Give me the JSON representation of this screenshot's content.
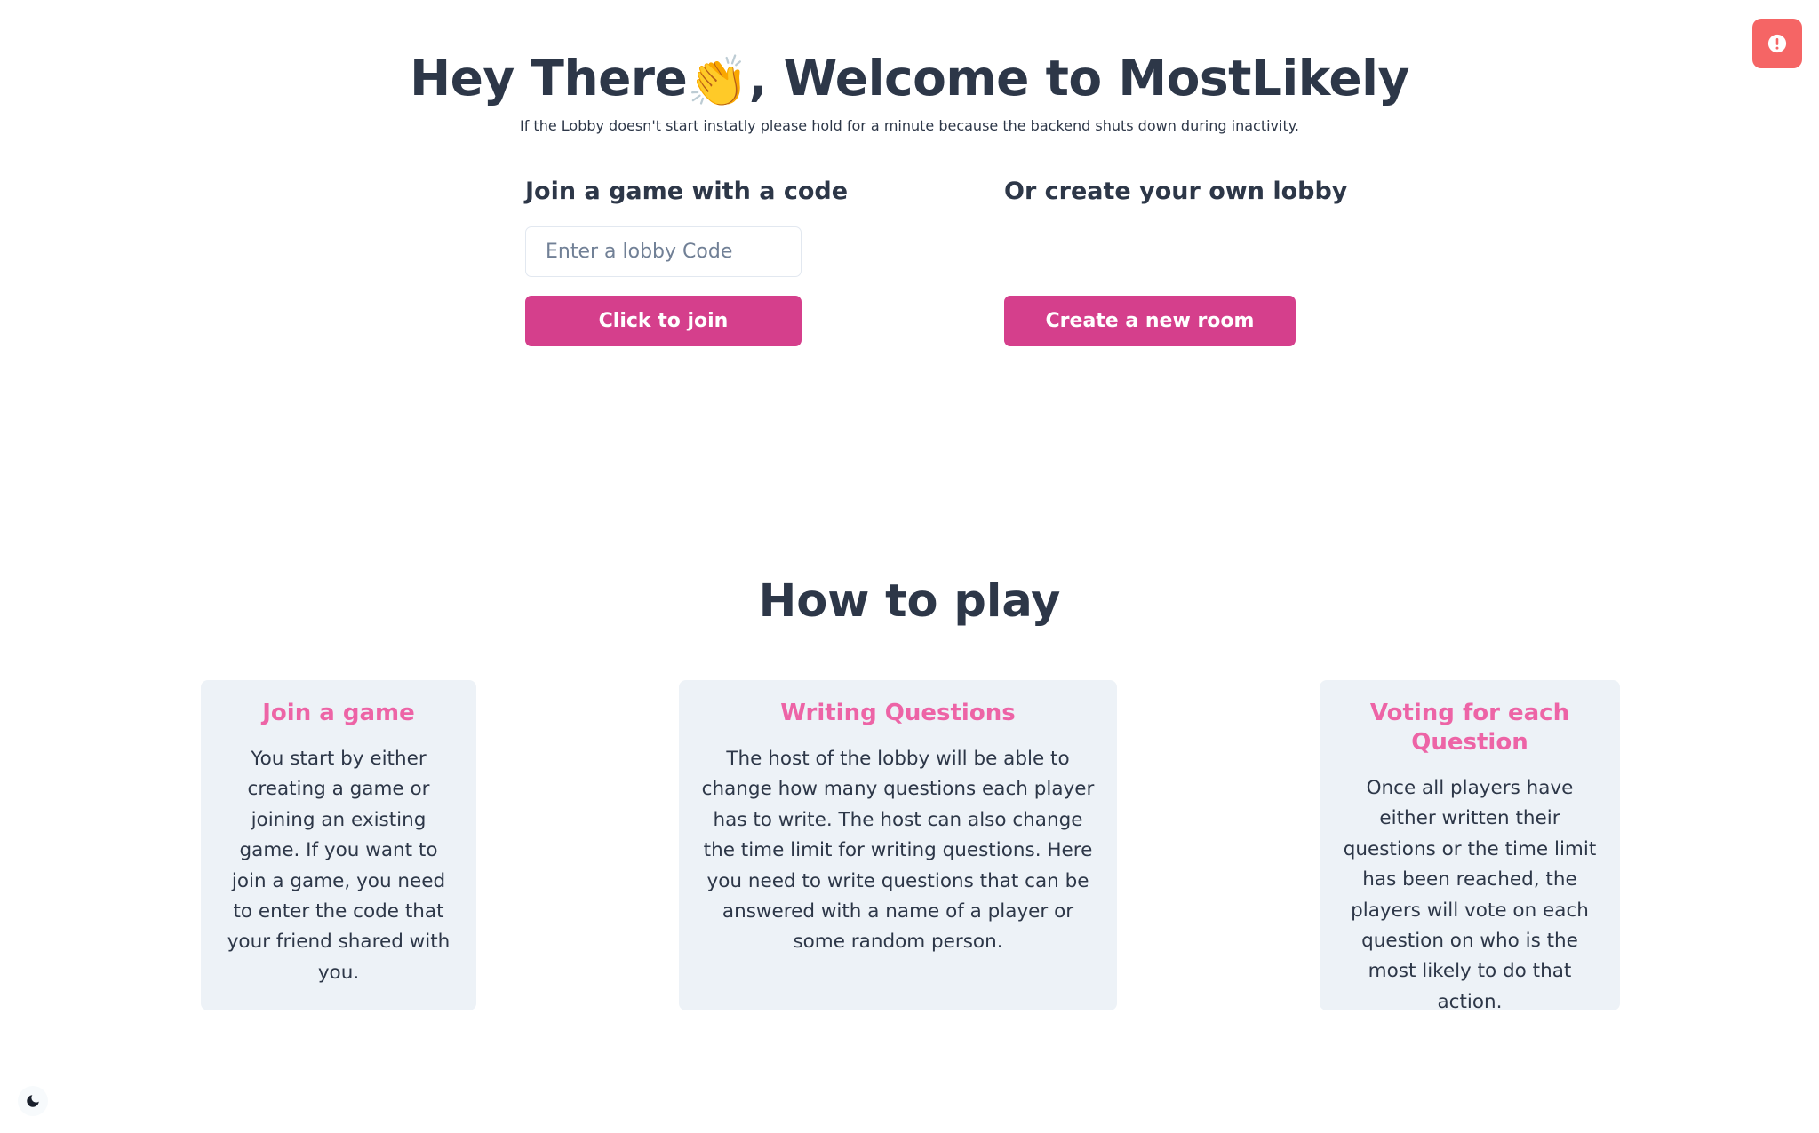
{
  "hero": {
    "title_before": "Hey There",
    "wave_emoji": "👏",
    "title_after": ", Welcome to MostLikely",
    "subtitle": "If the Lobby doesn't start instatly please hold for a minute because the backend shuts down during inactivity."
  },
  "join": {
    "heading": "Join a game with a code",
    "input_placeholder": "Enter a lobby Code",
    "input_value": "",
    "button_label": "Click to join"
  },
  "create": {
    "heading": "Or create your own lobby",
    "button_label": "Create a new room"
  },
  "howto": {
    "title": "How to play",
    "cards": [
      {
        "title": "Join a game",
        "text": "You start by either creating a game or joining an existing game. If you want to join a game, you need to enter the code that your friend shared with you."
      },
      {
        "title": "Writing Questions",
        "text": "The host of the lobby will be able to change how many questions each player has to write. The host can also change the time limit for writing questions. Here you need to write questions that can be answered with a name of a player or some random person."
      },
      {
        "title": "Voting for each Question",
        "text": "Once all players have either written their questions or the time limit has been reached, the players will vote on each question on who is the most likely to do that action."
      }
    ]
  },
  "icons": {
    "alert": "alert-circle-icon",
    "theme_toggle": "moon-icon"
  },
  "colors": {
    "primary_button": "#d53f8c",
    "card_title": "#ed64a6",
    "card_background": "#edf2f7",
    "alert_button": "#f56565",
    "text": "#2d3748"
  }
}
